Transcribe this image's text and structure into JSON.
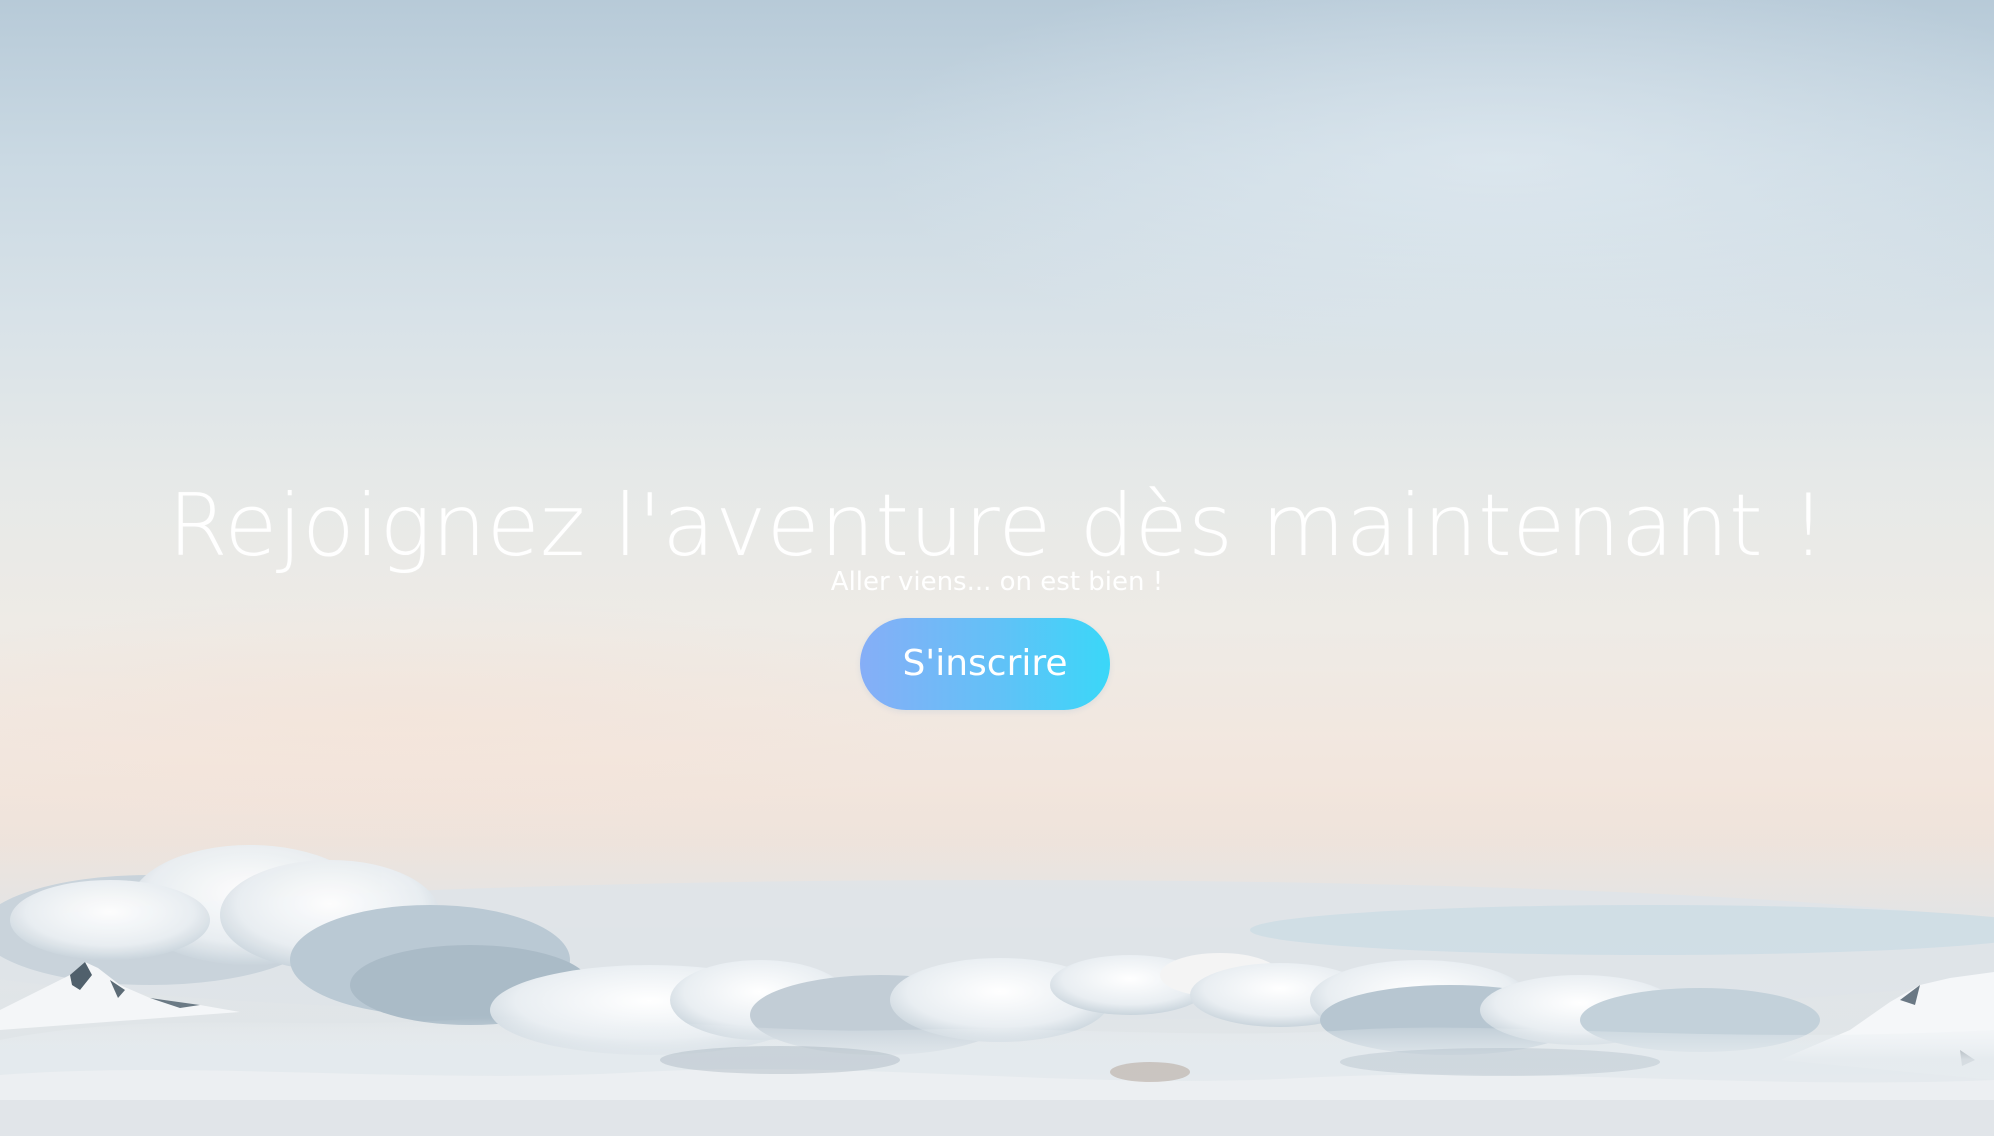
{
  "hero": {
    "headline": "Rejoignez l'aventure dès maintenant !",
    "subheadline": "Aller viens... on est bien !",
    "cta_label": "S'inscrire"
  },
  "colors": {
    "cta_gradient_start": "#86aef7",
    "cta_gradient_end": "#3ad7f8",
    "text": "#ffffff"
  }
}
